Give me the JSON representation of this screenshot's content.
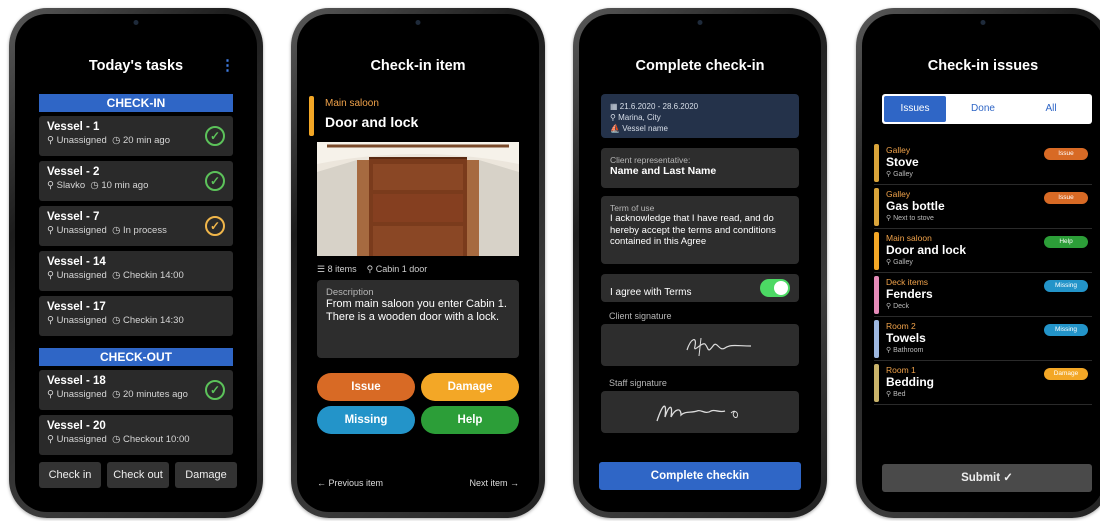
{
  "phone1": {
    "title": "Today's tasks",
    "menu_icon": "kebab-menu-icon",
    "checkin_header": "CHECK-IN",
    "checkout_header": "CHECK-OUT",
    "checkin_tasks": [
      {
        "name": "Vessel - 1",
        "assignee": "Unassigned",
        "time": "20 min ago",
        "status": "done"
      },
      {
        "name": "Vessel - 2",
        "assignee": "Slavko",
        "time": "10 min ago",
        "status": "done"
      },
      {
        "name": "Vessel - 7",
        "assignee": "Unassigned",
        "time": "In process",
        "status": "in-process"
      },
      {
        "name": "Vessel - 14",
        "assignee": "Unassigned",
        "time": "Checkin 14:00",
        "status": ""
      },
      {
        "name": "Vessel - 17",
        "assignee": "Unassigned",
        "time": "Checkin 14:30",
        "status": ""
      }
    ],
    "checkout_tasks": [
      {
        "name": "Vessel - 18",
        "assignee": "Unassigned",
        "time": "20 minutes ago",
        "status": "done"
      },
      {
        "name": "Vessel - 20",
        "assignee": "Unassigned",
        "time": "Checkout 10:00",
        "status": ""
      }
    ],
    "buttons": {
      "checkin": "Check in",
      "checkout": "Check out",
      "damage": "Damage"
    },
    "colors": {
      "section_bar": "#2f66c6",
      "done": "#5cc25a",
      "in_process": "#f0b64a"
    }
  },
  "phone2": {
    "title": "Check-in item",
    "category": "Main saloon",
    "item": "Door and lock",
    "items_count": "8 items",
    "location": "Cabin 1 door",
    "description_label": "Description",
    "description": "From main saloon you enter Cabin 1. There is a wooden door with a lock.",
    "actions": {
      "issue": "Issue",
      "damage": "Damage",
      "missing": "Missing",
      "help": "Help"
    },
    "prev": "Previous item",
    "next": "Next item",
    "colors": {
      "issue": "#d86a25",
      "damage": "#f3a726",
      "missing": "#2394c9",
      "help": "#2c9e38"
    }
  },
  "phone3": {
    "title": "Complete check-in",
    "dates": "21.6.2020 - 28.6.2020",
    "marina": "Marina, City",
    "vessel": "Vessel name",
    "rep_label": "Client representative:",
    "rep_value": "Name and Last Name",
    "terms_label": "Term of use",
    "terms_text": "I acknowledge that I have read, and do hereby accept the terms and conditions contained in this Agree",
    "agree_label": "I agree with Terms",
    "agree_on": true,
    "client_sig_label": "Client signature",
    "staff_sig_label": "Staff signature",
    "complete_button": "Complete checkin"
  },
  "phone4": {
    "title": "Check-in issues",
    "tabs": [
      "Issues",
      "Done",
      "All"
    ],
    "active_tab": "Issues",
    "issues": [
      {
        "category": "Galley",
        "name": "Stove",
        "location": "Galley",
        "badge": "Issue",
        "badge_color": "#d86a25",
        "bar_color": "#d9a43a"
      },
      {
        "category": "Galley",
        "name": "Gas bottle",
        "location": "Next to stove",
        "badge": "Issue",
        "badge_color": "#d86a25",
        "bar_color": "#d9a43a"
      },
      {
        "category": "Main saloon",
        "name": "Door and lock",
        "location": "Galley",
        "badge": "Help",
        "badge_color": "#2c9e38",
        "bar_color": "#f3a726"
      },
      {
        "category": "Deck items",
        "name": "Fenders",
        "location": "Deck",
        "badge": "Missing",
        "badge_color": "#2394c9",
        "bar_color": "#e58bb8"
      },
      {
        "category": "Room 2",
        "name": "Towels",
        "location": "Bathroom",
        "badge": "Missing",
        "badge_color": "#2394c9",
        "bar_color": "#9db7e0"
      },
      {
        "category": "Room 1",
        "name": "Bedding",
        "location": "Bed",
        "badge": "Damage",
        "badge_color": "#f3a726",
        "bar_color": "#c9b36a"
      }
    ],
    "submit": "Submit ✓"
  }
}
